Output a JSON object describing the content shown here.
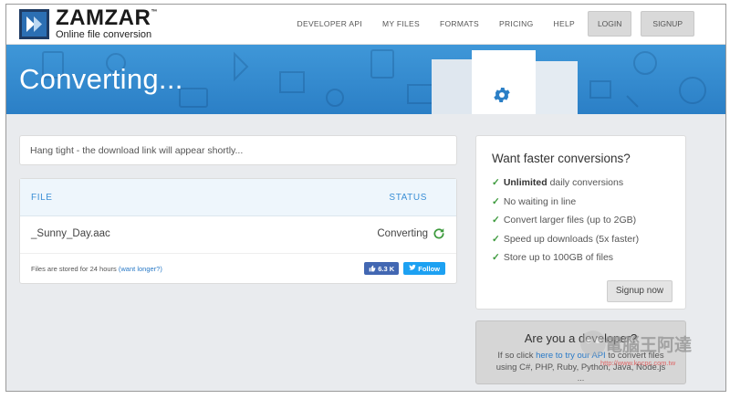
{
  "brand": {
    "name": "ZAMZAR",
    "trademark": "™",
    "tagline": "Online file conversion"
  },
  "nav": {
    "links": [
      "DEVELOPER API",
      "MY FILES",
      "FORMATS",
      "PRICING",
      "HELP"
    ],
    "login": "LOGIN",
    "signup": "SIGNUP"
  },
  "banner": {
    "title": "Converting..."
  },
  "notice": {
    "text": "Hang tight - the download link will appear shortly..."
  },
  "file_table": {
    "headers": {
      "file": "FILE",
      "status": "STATUS"
    },
    "rows": [
      {
        "name": "_Sunny_Day.aac",
        "status": "Converting",
        "status_icon": "refresh-icon"
      }
    ],
    "footer_text": "Files are stored for 24 hours",
    "footer_link": "(want longer?)",
    "like_count": "6.3 K",
    "follow_label": "Follow"
  },
  "promo": {
    "title": "Want faster conversions?",
    "items": [
      {
        "bold": "Unlimited",
        "text": " daily conversions"
      },
      {
        "bold": "",
        "text": "No waiting in line"
      },
      {
        "bold": "",
        "text": "Convert larger files (up to 2GB)"
      },
      {
        "bold": "",
        "text": "Speed up downloads (5x faster)"
      },
      {
        "bold": "",
        "text": "Store up to 100GB of files"
      }
    ],
    "cta": "Signup now"
  },
  "developer": {
    "title": "Are you a developer?",
    "line1_pre": "If so click ",
    "line1_link": "here to try our API",
    "line1_post": " to convert files",
    "line2": "using C#, PHP, Ruby, Python, Java, Node.js",
    "more": "..."
  },
  "watermark": {
    "text": "電腦王阿達",
    "url": "http://www.kocpc.com.tw"
  },
  "colors": {
    "banner": "#3f97d8",
    "link": "#2a7ac7",
    "check": "#3d9a3d",
    "facebook": "#4267b2",
    "twitter": "#1da1f2"
  }
}
